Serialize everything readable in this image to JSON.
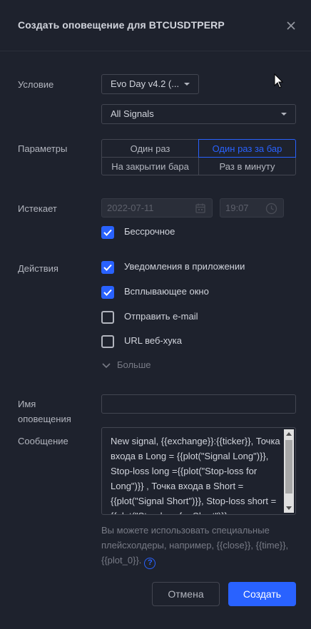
{
  "dialog": {
    "title": "Создать оповещение для BTCUSDTPERP"
  },
  "condition": {
    "label": "Условие",
    "indicator_value": "Evo Day v4.2 (...",
    "signal_value": "All Signals"
  },
  "params": {
    "label": "Параметры",
    "options": [
      "Один раз",
      "Один раз за бар",
      "На закрытии бара",
      "Раз в минуту"
    ],
    "selected": "Один раз за бар"
  },
  "expires": {
    "label": "Истекает",
    "date": "2022-07-11",
    "time": "19:07",
    "open_ended_label": "Бессрочное",
    "open_ended_checked": true
  },
  "actions": {
    "label": "Действия",
    "items": [
      {
        "label": "Уведомления в приложении",
        "checked": true
      },
      {
        "label": "Всплывающее окно",
        "checked": true
      },
      {
        "label": "Отправить e-mail",
        "checked": false
      },
      {
        "label": "URL веб-хука",
        "checked": false
      }
    ],
    "more_label": "Больше"
  },
  "alert_name": {
    "label": "Имя оповещения",
    "value": ""
  },
  "message": {
    "label": "Сообщение",
    "value": "New signal,  {{exchange}}:{{ticker}}, Точка входа в Long = {{plot(\"Signal Long\")}}, Stop-loss long ={{plot(\"Stop-loss for Long\")}} , Точка входа в Short = {{plot(\"Signal Short\")}}, Stop-loss short ={{plot(\"Stop-loss for Short\")}}"
  },
  "hint": {
    "text": "Вы можете использовать специальные плейсхолдеры, например, {{close}}, {{time}}, {{plot_0}}."
  },
  "buttons": {
    "cancel": "Отмена",
    "create": "Создать"
  },
  "colors": {
    "background": "#1e222d",
    "accent": "#2962ff",
    "text": "#d1d4dc",
    "muted": "#787b86"
  }
}
